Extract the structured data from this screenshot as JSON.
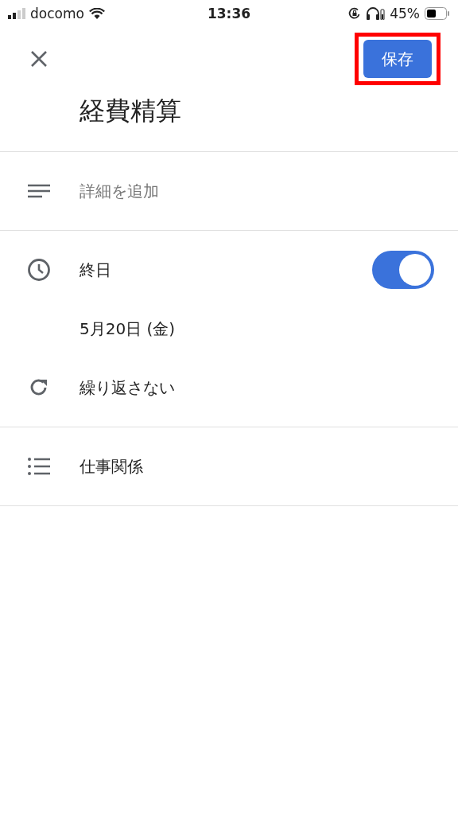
{
  "status_bar": {
    "carrier": "docomo",
    "time": "13:36",
    "battery": "45%"
  },
  "header": {
    "save_button": {
      "label": "保存",
      "highlighted": true
    }
  },
  "title": "経費精算",
  "sections": [
    {
      "rows": [
        {
          "kind": "description",
          "placeholder": "詳細を追加"
        }
      ]
    },
    {
      "rows": [
        {
          "kind": "allday",
          "label": "終日",
          "on": true
        },
        {
          "kind": "date",
          "label": "5月20日 (金)"
        },
        {
          "kind": "repeat",
          "label": "繰り返さない"
        }
      ]
    },
    {
      "rows": [
        {
          "kind": "list",
          "label": "仕事関係"
        }
      ]
    }
  ]
}
